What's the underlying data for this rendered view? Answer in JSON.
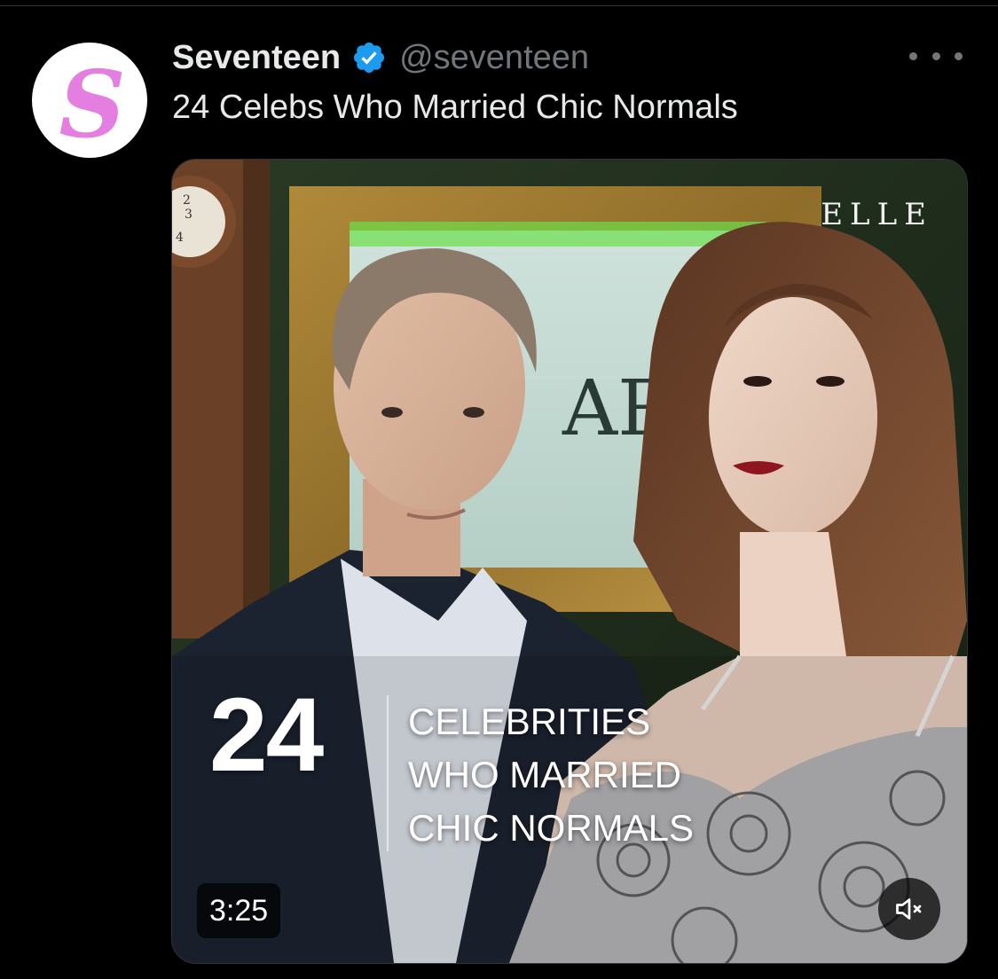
{
  "tweet": {
    "display_name": "Seventeen",
    "handle": "@seventeen",
    "text": "24 Celebs Who Married Chic Normals",
    "avatar_letter": "S",
    "verified": true,
    "more_icon": "ellipsis-icon"
  },
  "media": {
    "watermark": "ELLE",
    "overlay_number": "24",
    "overlay_lines": [
      "CELEBRITIES",
      "WHO MARRIED",
      "CHIC NORMALS"
    ],
    "sign_text": "AR",
    "clock_digits": [
      "2",
      "3",
      "4"
    ],
    "duration": "3:25",
    "mute_icon": "speaker-muted-icon"
  },
  "colors": {
    "background": "#000000",
    "text_primary": "#e7e9ea",
    "text_secondary": "#71767b",
    "verified_blue": "#1d9bf0",
    "avatar_pink": "#e47ee0"
  }
}
